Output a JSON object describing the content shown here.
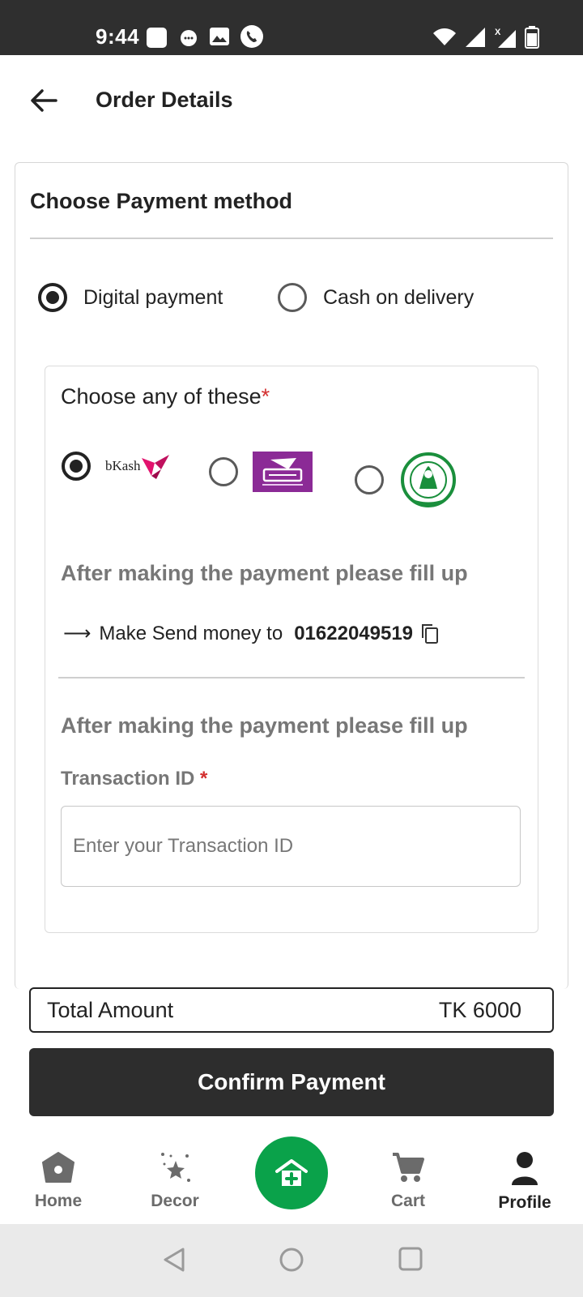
{
  "status_bar": {
    "time": "9:44",
    "left_icons": [
      "square-notification-icon",
      "message-icon",
      "image-icon",
      "phone-icon"
    ],
    "right_icons": [
      "wifi-icon",
      "signal-icon",
      "signal-x-icon",
      "battery-icon"
    ]
  },
  "header": {
    "title": "Order Details"
  },
  "payment": {
    "title": "Choose Payment method",
    "options": [
      {
        "label": "Digital payment",
        "selected": true
      },
      {
        "label": "Cash on delivery",
        "selected": false
      }
    ]
  },
  "digital": {
    "choose_label": "Choose any of these",
    "required_mark": "*",
    "providers": [
      {
        "name": "bKash",
        "selected": true
      },
      {
        "name": "Rocket",
        "selected": false
      },
      {
        "name": "bank-logo",
        "selected": false
      }
    ],
    "instruction_heading": "After making the payment please fill up",
    "send_money_label": "Make Send money to",
    "send_money_number": "01622049519",
    "instruction_heading_2": "After making the payment please fill up",
    "txn_label": "Transaction ID",
    "txn_required": "*",
    "txn_placeholder": "Enter your Transaction ID",
    "txn_value": ""
  },
  "total": {
    "label": "Total Amount",
    "value": "TK 6000"
  },
  "confirm_label": "Confirm Payment",
  "nav": {
    "items": [
      {
        "label": "Home",
        "icon": "home-icon"
      },
      {
        "label": "Decor",
        "icon": "decor-stars-icon"
      },
      {
        "label": "",
        "icon": "store-add-icon"
      },
      {
        "label": "Cart",
        "icon": "cart-icon"
      },
      {
        "label": "Profile",
        "icon": "profile-icon",
        "active": true
      }
    ]
  },
  "colors": {
    "status_bar": "#2f2f2f",
    "fab_green": "#0aa24a",
    "required_red": "#d32f2f",
    "confirm_button": "#2d2d2d"
  }
}
